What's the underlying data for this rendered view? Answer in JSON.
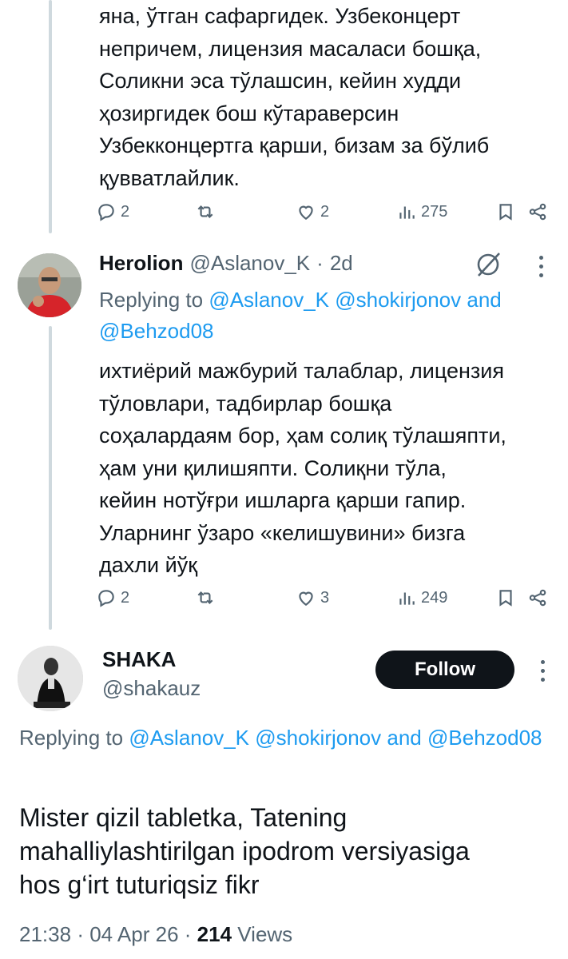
{
  "tweet1": {
    "text": "яна, ўтган сафаргидек. Узбеконцерт\nнепричем, лицензия масаласи бошқа,\nСоликни эса тўлашсин, кейин худди\nҳозиргидек бош кўтараверсин\nУзбекконцертга қарши, бизам за бўлиб\nқувватлайлик.",
    "replies": "2",
    "likes": "2",
    "views": "275"
  },
  "tweet2": {
    "name": "Herolion",
    "handle": "@Aslanov_K",
    "sep": "·",
    "time": "2d",
    "replying_prefix": "Replying to",
    "replying_mentions": "@Aslanov_K @shokirjonov",
    "replying_and": "and",
    "replying_last": "@Behzod08",
    "text": "ихтиёрий мажбурий талаблар, лицензия\nтўловлари, тадбирлар бошқа\nсоҳалардаям бор, ҳам солиқ тўлашяпти,\nҳам уни қилишяпти. Солиқни тўла,\nкейин нотўғри ишларга қарши гапир.\nУларнинг ўзаро «келишувини» бизга\nдахли йўқ",
    "replies": "2",
    "likes": "3",
    "views": "249"
  },
  "tweet3": {
    "name": "SHAKA",
    "handle": "@shakauz",
    "follow_label": "Follow",
    "replying_prefix": "Replying to",
    "replying_mentions": "@Aslanov_K @shokirjonov",
    "replying_and": "and",
    "replying_last": "@Behzod08",
    "text": "Mister qizil tabletka, Tatening\nmahalliylashtirilgan ipodrom versiyasiga\nhos g‘irt tuturiqsiz fikr",
    "time": "21:38",
    "date": "04 Apr 26",
    "sep": "·",
    "views_count": "214",
    "views_label": "Views"
  },
  "icons": {
    "reply": "reply-icon",
    "repost": "repost-icon",
    "like": "heart-icon",
    "views": "views-icon",
    "bookmark": "bookmark-icon",
    "share": "share-icon",
    "grok": "grok-icon",
    "more": "more-icon"
  },
  "colors": {
    "link": "#1d9bf0",
    "secondary": "#536471",
    "primary": "#0f1419",
    "thread_line": "#cfd9de"
  }
}
